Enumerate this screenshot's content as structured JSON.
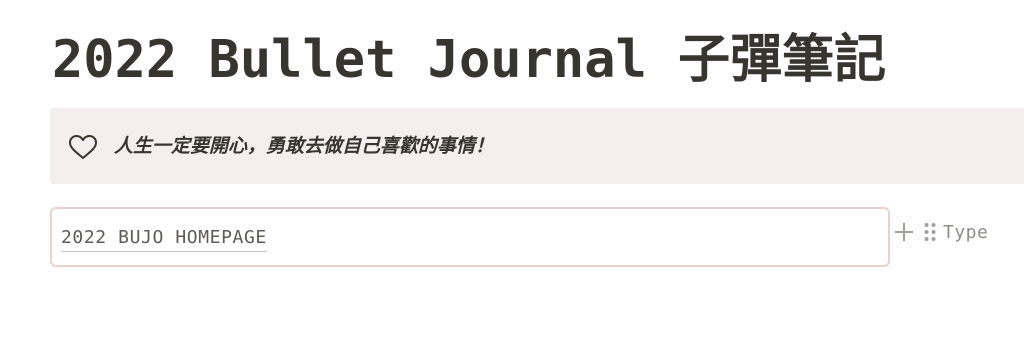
{
  "page": {
    "title": "2022 Bullet Journal 子彈筆記"
  },
  "callout": {
    "icon": "heart-outline-icon",
    "text": "人生一定要開心，勇敢去做自己喜歡的事情！",
    "background": "#f4eeee"
  },
  "link_block": {
    "label": "2022 BUJO HOMEPAGE",
    "border_color": "#e9d2cb"
  },
  "block_tools": {
    "add_icon": "plus-icon",
    "drag_icon": "drag-handle-icon",
    "placeholder": "Type"
  }
}
